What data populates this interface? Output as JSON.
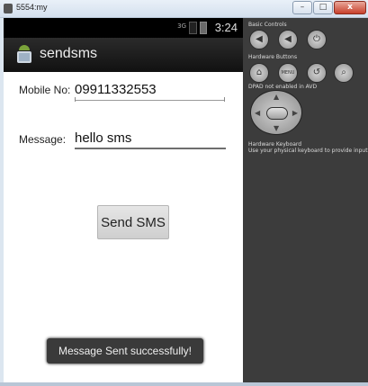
{
  "window": {
    "title": "5554:my",
    "minimize": "–",
    "maximize": "□",
    "close": "x"
  },
  "status_bar": {
    "network": "3G",
    "time": "3:24"
  },
  "action_bar": {
    "title": "sendsms"
  },
  "form": {
    "mobile_label": "Mobile No:",
    "mobile_value": "09911332553",
    "message_label": "Message:",
    "message_value": "hello sms",
    "send_label": "Send SMS"
  },
  "toast": {
    "text": "Message Sent successfully!"
  },
  "controls": {
    "basic_caption": "Basic Controls",
    "hardware_caption": "Hardware Buttons",
    "dpad_caption": "DPAD not enabled in AVD",
    "keyboard_caption": "Hardware Keyboard",
    "keyboard_hint": "Use your physical keyboard to provide input",
    "menu_label": "MENU",
    "icons": [
      "volume-down-icon",
      "volume-up-icon",
      "power-icon",
      "home-icon",
      "menu-icon",
      "back-icon",
      "search-icon"
    ]
  }
}
